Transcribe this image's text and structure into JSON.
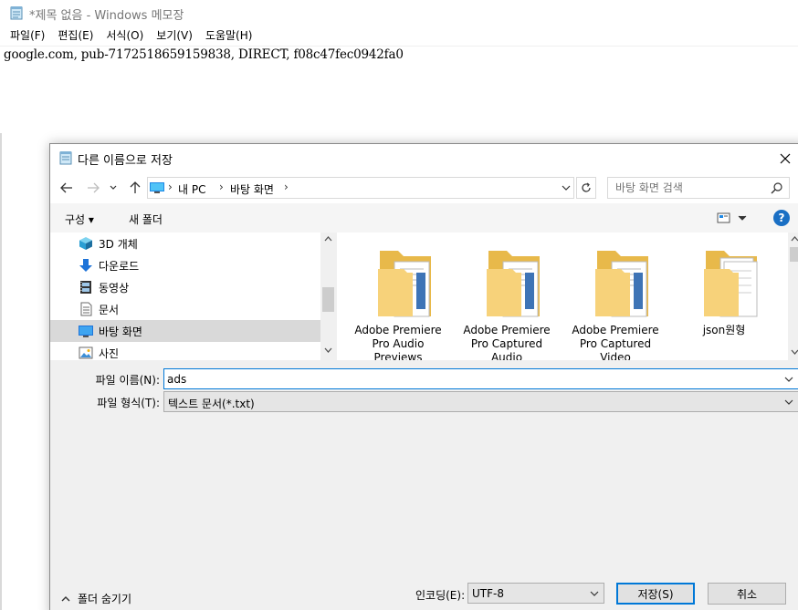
{
  "notepad": {
    "title": "*제목 없음 - Windows 메모장",
    "menu": [
      "파일(F)",
      "편집(E)",
      "서식(O)",
      "보기(V)",
      "도움말(H)"
    ],
    "content": "google.com, pub-7172518659159838, DIRECT, f08c47fec0942fa0"
  },
  "dialog": {
    "title": "다른 이름으로 저장",
    "breadcrumb": [
      "내 PC",
      "바탕 화면"
    ],
    "search_placeholder": "바탕 화면 검색",
    "toolbar": {
      "organize": "구성 ▾",
      "new_folder": "새 폴더",
      "help": "?"
    },
    "nav_items": [
      {
        "label": "3D 개체",
        "icon": "cube-3d-icon"
      },
      {
        "label": "다운로드",
        "icon": "download-arrow-icon"
      },
      {
        "label": "동영상",
        "icon": "video-icon"
      },
      {
        "label": "문서",
        "icon": "document-icon"
      },
      {
        "label": "바탕 화면",
        "icon": "desktop-icon",
        "selected": true
      },
      {
        "label": "사진",
        "icon": "pictures-icon"
      }
    ],
    "files": [
      {
        "name_lines": [
          "Adobe Premiere",
          "Pro Audio",
          "Previews"
        ]
      },
      {
        "name_lines": [
          "Adobe Premiere",
          "Pro Captured",
          "Audio"
        ]
      },
      {
        "name_lines": [
          "Adobe Premiere",
          "Pro Captured",
          "Video"
        ]
      },
      {
        "name_lines": [
          "json원형"
        ]
      }
    ],
    "filename_label": "파일 이름(N):",
    "filename_value": "ads",
    "filetype_label": "파일 형식(T):",
    "filetype_value": "텍스트 문서(*.txt)",
    "hide_folders": "폴더 숨기기",
    "encoding_label": "인코딩(E):",
    "encoding_value": "UTF-8",
    "save_button": "저장(S)",
    "cancel_button": "취소"
  }
}
